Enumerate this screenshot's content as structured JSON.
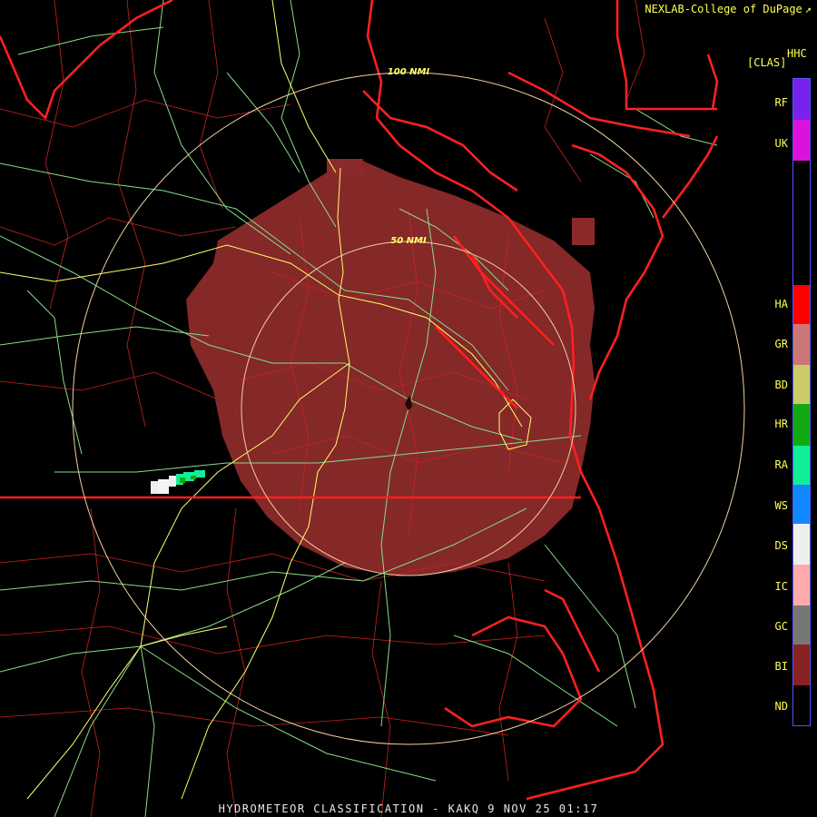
{
  "header": {
    "credit": "NEXLAB-College of DuPage"
  },
  "footer": {
    "title": "HYDROMETEOR CLASSIFICATION - KAKQ 9 NOV 25 01:17"
  },
  "legend": {
    "product": "HHC",
    "units": "[CLAS]",
    "classes": [
      {
        "code": "RF",
        "color": "#7722ee"
      },
      {
        "code": "UK",
        "color": "#dd11dd"
      },
      {
        "code": "HA",
        "color": "#ff0000"
      },
      {
        "code": "GR",
        "color": "#cc7777"
      },
      {
        "code": "BD",
        "color": "#cccc66"
      },
      {
        "code": "HR",
        "color": "#11aa11"
      },
      {
        "code": "RA",
        "color": "#11ee99"
      },
      {
        "code": "WS",
        "color": "#1188ff"
      },
      {
        "code": "DS",
        "color": "#eeeeee"
      },
      {
        "code": "IC",
        "color": "#ffaaaa"
      },
      {
        "code": "GC",
        "color": "#777777"
      },
      {
        "code": "BI",
        "color": "#882222"
      },
      {
        "code": "ND",
        "color": "#000000"
      }
    ]
  },
  "range_rings": {
    "inner": "50 NMI",
    "outer": "100 NMI"
  },
  "colors": {
    "state_border": "#ff2020",
    "county_border": "#cc2222",
    "highway": "#ffff66",
    "road": "#88dd88",
    "echo": "#8b2a2a"
  }
}
